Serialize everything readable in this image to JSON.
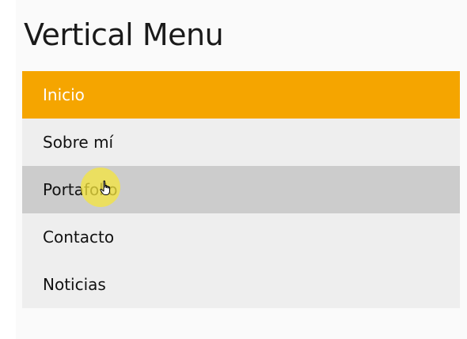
{
  "title": "Vertical Menu",
  "menu": {
    "items": [
      {
        "label": "Inicio",
        "state": "active"
      },
      {
        "label": "Sobre mí",
        "state": "normal"
      },
      {
        "label": "Portafolio",
        "state": "hover"
      },
      {
        "label": "Contacto",
        "state": "normal"
      },
      {
        "label": "Noticias",
        "state": "normal"
      }
    ]
  },
  "colors": {
    "active_background": "#f5a500",
    "item_background": "#eeeeee",
    "hover_background": "#cccccc",
    "cursor_highlight": "#f5e63c"
  },
  "cursor": {
    "icon": "hand-pointer-icon"
  }
}
